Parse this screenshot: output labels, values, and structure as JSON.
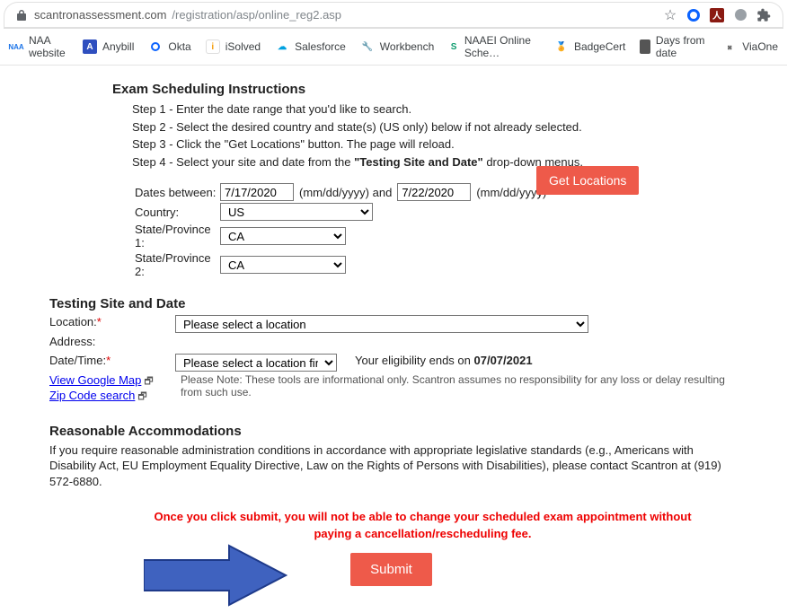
{
  "browser": {
    "url_host": "scantronassessment.com",
    "url_path": "/registration/asp/online_reg2.asp",
    "right_icons": [
      "star",
      "circle-blue",
      "acrobat",
      "grey-circle",
      "puzzle"
    ]
  },
  "bookmarks": [
    {
      "label": "NAA website",
      "icon": "bm-naa",
      "glyph": "NAA"
    },
    {
      "label": "Anybill",
      "icon": "bm-anybill",
      "glyph": "A"
    },
    {
      "label": "Okta",
      "icon": "bm-okta",
      "glyph": "O"
    },
    {
      "label": "iSolved",
      "icon": "bm-isolved",
      "glyph": "i"
    },
    {
      "label": "Salesforce",
      "icon": "bm-sf",
      "glyph": "☁"
    },
    {
      "label": "Workbench",
      "icon": "bm-wb",
      "glyph": "🔧"
    },
    {
      "label": "NAAEI Online Sche…",
      "icon": "bm-naaei",
      "glyph": "S"
    },
    {
      "label": "BadgeCert",
      "icon": "bm-badge",
      "glyph": "🏅"
    },
    {
      "label": "Days from date",
      "icon": "bm-days",
      "glyph": ""
    },
    {
      "label": "ViaOne",
      "icon": "bm-viaone",
      "glyph": "𝄪"
    }
  ],
  "headings": {
    "instructions": "Exam Scheduling Instructions",
    "testing": "Testing Site and Date",
    "accom": "Reasonable Accommodations"
  },
  "steps": {
    "s1": "Step 1 - Enter the date range that you'd like to search.",
    "s2": "Step 2 - Select the desired country and state(s) (US only) below if not already selected.",
    "s3": "Step 3 - Click the \"Get Locations\" button. The page will reload.",
    "s4_pre": "Step 4 - Select your site and date from the ",
    "s4_bold": "\"Testing Site and Date\"",
    "s4_post": " drop-down menus."
  },
  "labels": {
    "dates_between": "Dates between:",
    "dates_mid": "(mm/dd/yyyy) and",
    "dates_end": "(mm/dd/yyyy)",
    "country": "Country:",
    "state1": "State/Province 1:",
    "state2": "State/Province 2:",
    "location": "Location:",
    "address": "Address:",
    "datetime": "Date/Time:",
    "view_map": "View Google Map",
    "zip_search": "Zip Code search"
  },
  "form": {
    "date_from": "7/17/2020",
    "date_to": "7/22/2020",
    "country": "US",
    "state1": "CA",
    "state2": "CA",
    "location_placeholder": "Please select a location",
    "datetime_placeholder": "Please select a location first"
  },
  "buttons": {
    "get_locations": "Get Locations",
    "submit": "Submit"
  },
  "eligibility": {
    "pre": "Your eligibility ends on ",
    "date": "07/07/2021"
  },
  "tool_note": "Please Note: These tools are informational only. Scantron assumes no responsibility for any loss or delay resulting from such use.",
  "accom_text": "If you require reasonable administration conditions in accordance with appropriate legislative standards (e.g., Americans with Disability Act, EU Employment Equality Directive, Law on the Rights of Persons with Disabilities), please contact Scantron at (919) 572-6880.",
  "warning": "Once you click submit, you will not be able to change your scheduled exam appointment without paying a cancellation/rescheduling fee."
}
